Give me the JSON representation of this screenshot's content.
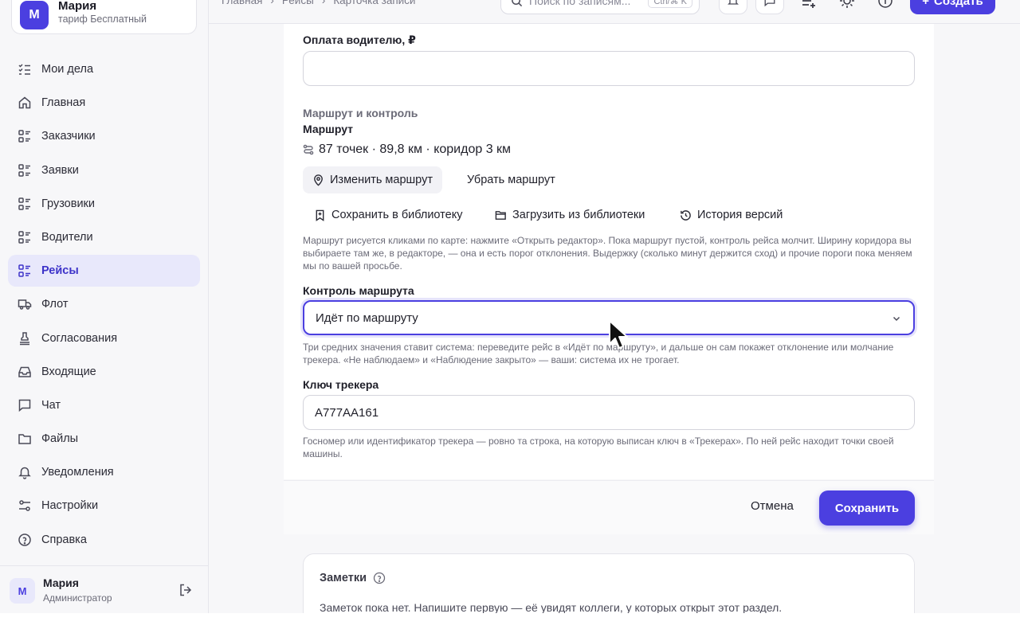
{
  "org": {
    "avatar": "М",
    "name": "Мария",
    "plan": "тариф Бесплатный"
  },
  "nav": [
    {
      "label": "Мои дела",
      "icon": "checklist-icon"
    },
    {
      "label": "Главная",
      "icon": "home-icon"
    },
    {
      "label": "Заказчики",
      "icon": "list-icon"
    },
    {
      "label": "Заявки",
      "icon": "list-icon"
    },
    {
      "label": "Грузовики",
      "icon": "list-icon"
    },
    {
      "label": "Водители",
      "icon": "list-icon"
    },
    {
      "label": "Рейсы",
      "icon": "list-icon",
      "active": true
    },
    {
      "label": "Флот",
      "icon": "truck-icon"
    },
    {
      "label": "Согласования",
      "icon": "stamp-icon"
    },
    {
      "label": "Входящие",
      "icon": "inbox-icon"
    },
    {
      "label": "Чат",
      "icon": "chat-icon"
    },
    {
      "label": "Файлы",
      "icon": "folder-icon"
    },
    {
      "label": "Уведомления",
      "icon": "bell-icon"
    },
    {
      "label": "Настройки",
      "icon": "sliders-icon"
    },
    {
      "label": "Справка",
      "icon": "help-icon"
    }
  ],
  "user": {
    "avatar": "М",
    "name": "Мария",
    "role": "Администратор"
  },
  "breadcrumb": [
    "Главная",
    "Рейсы",
    "Карточка записи"
  ],
  "search": {
    "placeholder": "Поиск по записям...",
    "shortcut": "Ctrl/⌘ K"
  },
  "topbar": {
    "create_label": "Создать"
  },
  "form": {
    "driver_pay_label": "Оплата водителю, ₽",
    "driver_pay_value": "",
    "section_title": "Маршрут и контроль",
    "route_label": "Маршрут",
    "route_summary": "87 точек · 89,8 км · коридор 3 км",
    "edit_route": "Изменить маршрут",
    "remove_route": "Убрать маршрут",
    "save_library": "Сохранить в библиотеку",
    "load_library": "Загрузить из библиотеки",
    "version_history": "История версий",
    "route_help": "Маршрут рисуется кликами по карте: нажмите «Открыть редактор». Пока маршрут пустой, контроль рейса молчит. Ширину коридора вы выбираете там же, в редакторе, — она и есть порог отклонения. Выдержку (сколько минут держится сход) и прочие пороги пока меняем мы по вашей просьбе.",
    "control_label": "Контроль маршрута",
    "control_value": "Идёт по маршруту",
    "control_help": "Три средних значения ставит система: переведите рейс в «Идёт по маршруту», и дальше он сам покажет отклонение или молчание трекера. «Не наблюдаем» и «Наблюдение закрыто» — ваши: система их не трогает.",
    "tracker_label": "Ключ трекера",
    "tracker_value": "А777АА161",
    "tracker_help": "Госномер или идентификатор трекера — ровно та строка, на которую выписан ключ в «Трекерах». По ней рейс находит точки своей машины."
  },
  "actions": {
    "cancel": "Отмена",
    "save": "Сохранить"
  },
  "notes": {
    "title": "Заметки",
    "empty": "Заметок пока нет. Напишите первую — её увидят коллеги, у которых открыт этот раздел."
  },
  "colors": {
    "accent": "#4b3fe0",
    "active_bg": "#e8e8fb"
  }
}
